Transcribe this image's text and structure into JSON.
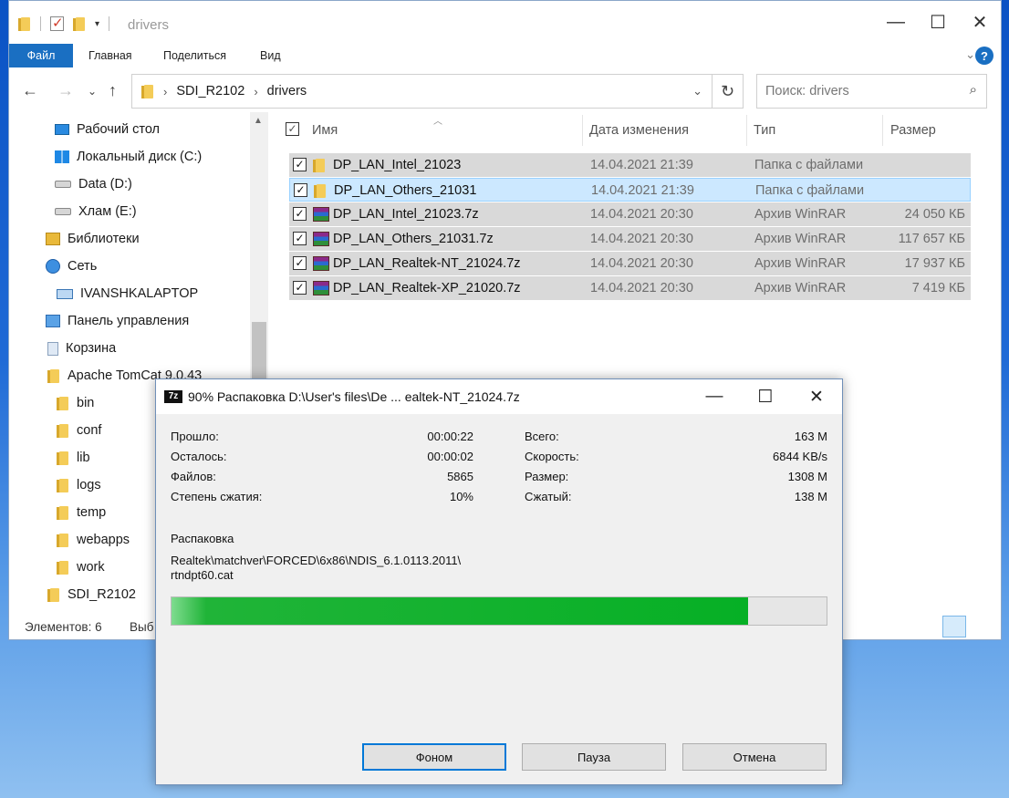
{
  "explorer": {
    "title": "drivers",
    "ribbon": {
      "file": "Файл",
      "home": "Главная",
      "share": "Поделиться",
      "view": "Вид"
    },
    "address": {
      "part1": "SDI_R2102",
      "part2": "drivers"
    },
    "search_placeholder": "Поиск: drivers",
    "nav": [
      {
        "label": "Рабочий стол",
        "icon": "desktop-icon"
      },
      {
        "label": "Локальный диск (C:)",
        "icon": "windows-drive-icon"
      },
      {
        "label": "Data (D:)",
        "icon": "drive-icon"
      },
      {
        "label": "Хлам (E:)",
        "icon": "drive-icon"
      },
      {
        "label": "Библиотеки",
        "icon": "library-icon"
      },
      {
        "label": "Сеть",
        "icon": "network-icon"
      },
      {
        "label": "IVANSHKALAPTOP",
        "icon": "computer-icon"
      },
      {
        "label": "Панель управления",
        "icon": "control-panel-icon"
      },
      {
        "label": "Корзина",
        "icon": "recycle-bin-icon"
      },
      {
        "label": "Apache TomCat 9.0.43",
        "icon": "folder-icon"
      },
      {
        "label": "bin",
        "icon": "folder-icon"
      },
      {
        "label": "conf",
        "icon": "folder-icon"
      },
      {
        "label": "lib",
        "icon": "folder-icon"
      },
      {
        "label": "logs",
        "icon": "folder-icon"
      },
      {
        "label": "temp",
        "icon": "folder-icon"
      },
      {
        "label": "webapps",
        "icon": "folder-icon"
      },
      {
        "label": "work",
        "icon": "folder-icon"
      },
      {
        "label": "SDI_R2102",
        "icon": "folder-icon"
      }
    ],
    "columns": {
      "name": "Имя",
      "date": "Дата изменения",
      "type": "Тип",
      "size": "Размер"
    },
    "files": [
      {
        "name": "DP_LAN_Intel_21023",
        "date": "14.04.2021 21:39",
        "type": "Папка с файлами",
        "size": "",
        "icon": "folder-icon"
      },
      {
        "name": "DP_LAN_Others_21031",
        "date": "14.04.2021 21:39",
        "type": "Папка с файлами",
        "size": "",
        "icon": "folder-icon"
      },
      {
        "name": "DP_LAN_Intel_21023.7z",
        "date": "14.04.2021 20:30",
        "type": "Архив WinRAR",
        "size": "24 050 КБ",
        "icon": "winrar-archive-icon"
      },
      {
        "name": "DP_LAN_Others_21031.7z",
        "date": "14.04.2021 20:30",
        "type": "Архив WinRAR",
        "size": "117 657 КБ",
        "icon": "winrar-archive-icon"
      },
      {
        "name": "DP_LAN_Realtek-NT_21024.7z",
        "date": "14.04.2021 20:30",
        "type": "Архив WinRAR",
        "size": "17 937 КБ",
        "icon": "winrar-archive-icon"
      },
      {
        "name": "DP_LAN_Realtek-XP_21020.7z",
        "date": "14.04.2021 20:30",
        "type": "Архив WinRAR",
        "size": "7 419 КБ",
        "icon": "winrar-archive-icon"
      }
    ],
    "status": {
      "count": "Элементов: 6",
      "selected": "Выб"
    }
  },
  "zip": {
    "title": "90% Распаковка D:\\User's files\\De ... ealtek-NT_21024.7z",
    "logo": "7z",
    "stats_left": [
      {
        "label": "Прошло:",
        "value": "00:00:22"
      },
      {
        "label": "Осталось:",
        "value": "00:00:02"
      },
      {
        "label": "Файлов:",
        "value": "5865"
      },
      {
        "label": "Степень сжатия:",
        "value": "10%"
      }
    ],
    "stats_right": [
      {
        "label": "Всего:",
        "value": "163 M"
      },
      {
        "label": "Скорость:",
        "value": "6844 KB/s"
      },
      {
        "label": "Размер:",
        "value": "1308 M"
      },
      {
        "label": "Сжатый:",
        "value": "138 M"
      }
    ],
    "operation": "Распаковка",
    "path_line1": "Realtek\\matchver\\FORCED\\6x86\\NDIS_6.1.0113.2011\\",
    "path_line2": "rtndpt60.cat",
    "progress": 0.88,
    "buttons": {
      "background": "Фоном",
      "pause": "Пауза",
      "cancel": "Отмена"
    }
  }
}
